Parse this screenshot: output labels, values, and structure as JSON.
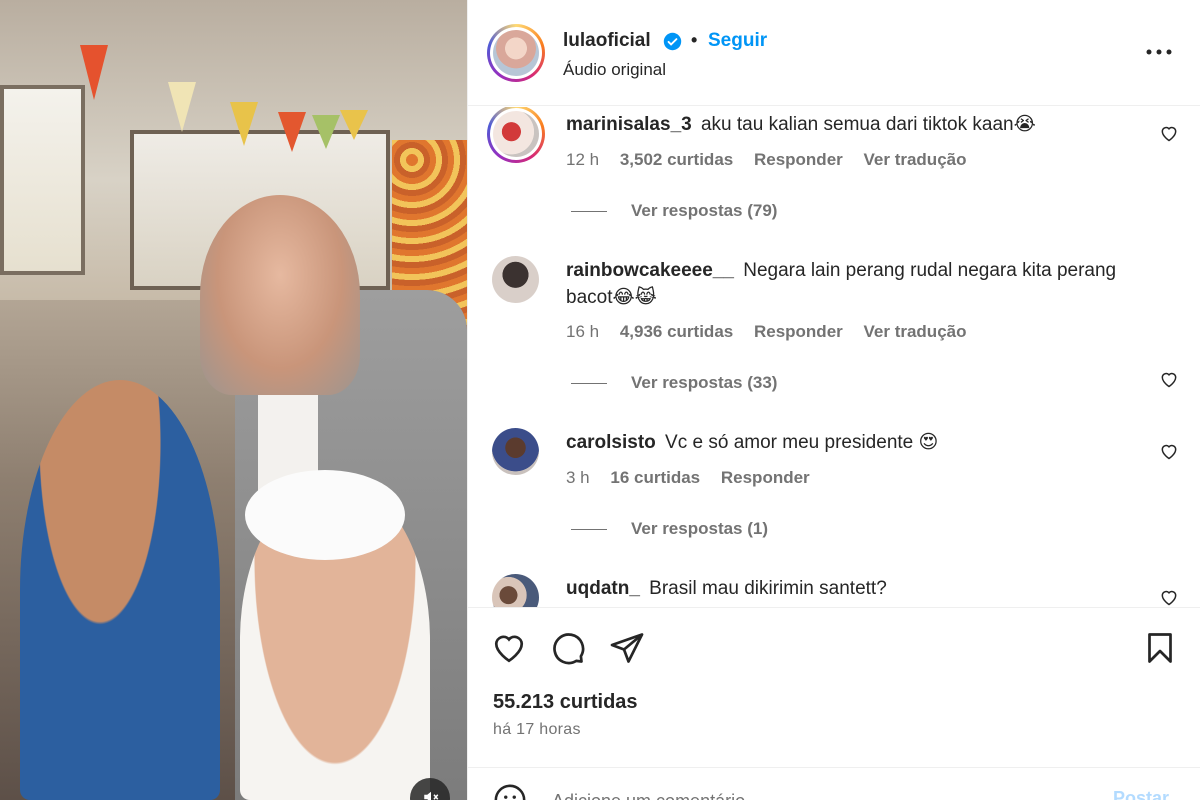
{
  "header": {
    "username": "lulaoficial",
    "follow_label": "Seguir",
    "separator": "•",
    "audio_label": "Áudio original",
    "more_icon": "more-horizontal-icon"
  },
  "comments": [
    {
      "username": "marinisalas_3",
      "text": "aku tau kalian semua dari tiktok kaan😭",
      "age": "12 h",
      "likes": "3,502 curtidas",
      "reply_label": "Responder",
      "translate_label": "Ver tradução",
      "replies_label": "Ver respostas (79)"
    },
    {
      "username": "rainbowcakeeee__",
      "text": "Negara lain perang rudal negara kita perang bacot😂😹",
      "age": "16 h",
      "likes": "4,936 curtidas",
      "reply_label": "Responder",
      "translate_label": "Ver tradução",
      "replies_label": "Ver respostas (33)"
    },
    {
      "username": "carolsisto",
      "text": "Vc e só amor meu presidente 😍",
      "age": "3 h",
      "likes": "16 curtidas",
      "reply_label": "Responder",
      "replies_label": "Ver respostas (1)"
    },
    {
      "username": "uqdatn_",
      "text": "Brasil mau dikirimin santett?"
    }
  ],
  "actions": {
    "likes": "55.213 curtidas",
    "time": "há 17 horas"
  },
  "add_comment": {
    "placeholder": "Adicione um comentário...",
    "post_label": "Postar"
  },
  "colors": {
    "accent": "#0095f6",
    "text": "#262626",
    "muted": "#737373",
    "post_disabled": "#b3dbff"
  }
}
